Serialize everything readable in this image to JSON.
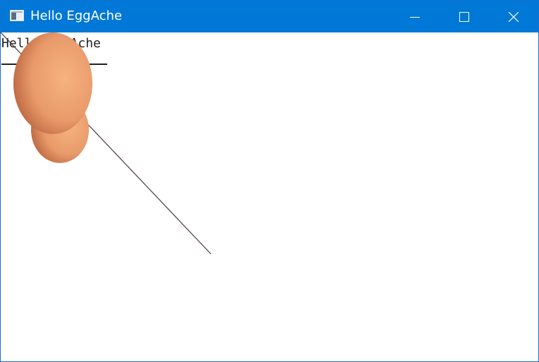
{
  "window": {
    "title": "Hello EggAche",
    "icon": "app-window-icon",
    "controls": {
      "minimize_icon": "minimize-icon",
      "maximize_icon": "maximize-icon",
      "close_icon": "close-icon"
    },
    "titlebar_color": "#0078d7"
  },
  "canvas": {
    "text": "Hello EggAche",
    "egg_color": "#f0a070",
    "line_color": "#4a3a36"
  }
}
